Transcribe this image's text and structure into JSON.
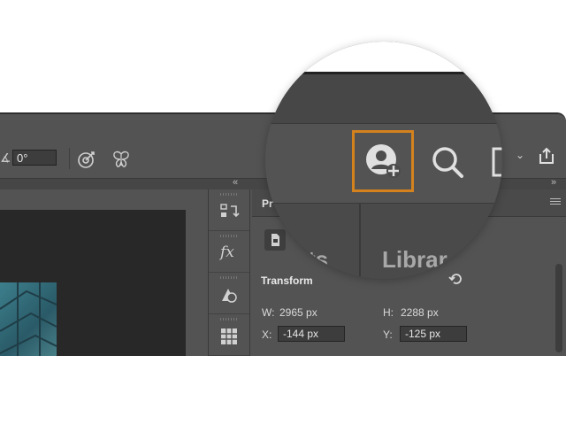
{
  "options_bar": {
    "angle_value": "0°"
  },
  "panel": {
    "title": "Pr",
    "section_title": "Transform",
    "width_label": "W:",
    "width_value": "2965 px",
    "height_label": "H:",
    "height_value": "2288 px",
    "x_label": "X:",
    "x_value": "-144 px",
    "y_label": "Y:",
    "y_value": "-125 px"
  },
  "magnifier": {
    "tab_partial_left": "ts",
    "tab_libraries": "Librar"
  },
  "icon_strip": {
    "fx_label": "fx"
  },
  "colors": {
    "highlight": "#d4821d",
    "ui_background": "#535353"
  }
}
